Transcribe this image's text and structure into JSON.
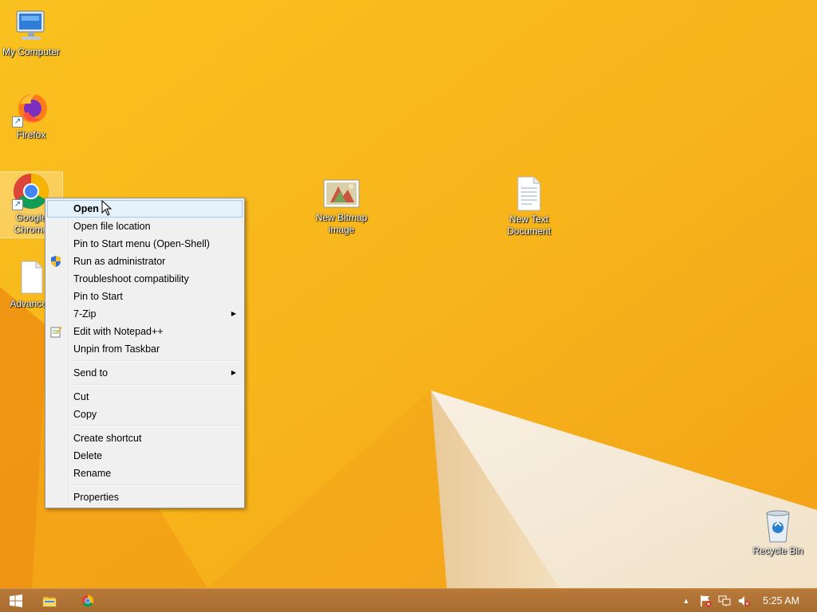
{
  "desktop": {
    "icons": [
      {
        "label": "My Computer"
      },
      {
        "label": "Firefox"
      },
      {
        "label": "Google Chrome",
        "label_visible": "Google\nChrom"
      },
      {
        "label": "Advanced",
        "label_visible": "Advanced"
      },
      {
        "label": "New Bitmap image"
      },
      {
        "label": "New Text Document"
      },
      {
        "label": "Recycle Bin"
      }
    ]
  },
  "context_menu": {
    "items": [
      {
        "label": "Open",
        "highlighted": true
      },
      {
        "label": "Open file location"
      },
      {
        "label": "Pin to Start menu (Open-Shell)"
      },
      {
        "label": "Run as administrator",
        "icon": "uac-shield-icon"
      },
      {
        "label": "Troubleshoot compatibility"
      },
      {
        "label": "Pin to Start"
      },
      {
        "label": "7-Zip",
        "submenu": true
      },
      {
        "label": "Edit with Notepad++",
        "icon": "notepadpp-icon"
      },
      {
        "label": "Unpin from Taskbar"
      },
      {
        "label": "Send to",
        "submenu": true
      },
      {
        "label": "Cut"
      },
      {
        "label": "Copy"
      },
      {
        "label": "Create shortcut"
      },
      {
        "label": "Delete"
      },
      {
        "label": "Rename"
      },
      {
        "label": "Properties"
      }
    ]
  },
  "taskbar": {
    "start_icon": "windows-logo-icon",
    "pinned": [
      "file-explorer-icon",
      "chrome-icon"
    ],
    "tray_icons": [
      "show-hidden-icons-chevron",
      "action-center-flag-icon",
      "network-icon",
      "volume-muted-icon"
    ],
    "clock": "5:25 AM"
  },
  "colors": {
    "wallpaper": "#f7b21a",
    "taskbar": "#b07234",
    "menu_bg": "#f0f0f0",
    "menu_highlight": "#e5f1fb"
  }
}
